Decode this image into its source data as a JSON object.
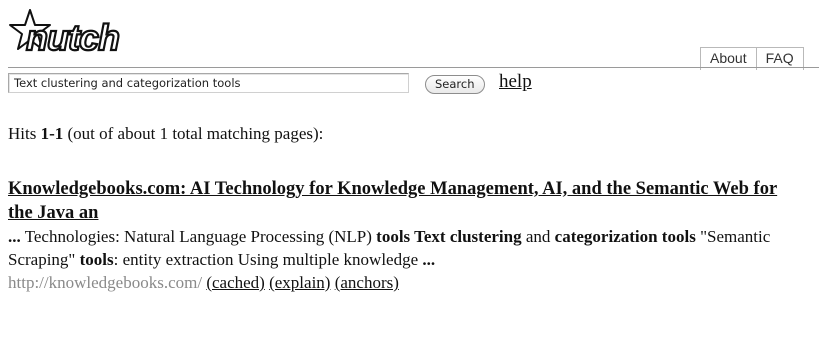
{
  "logo": {
    "text": "nutch",
    "icon": "star-logo-icon",
    "color": "#111111"
  },
  "tabs": [
    {
      "label": "About"
    },
    {
      "label": "FAQ"
    }
  ],
  "search": {
    "value": "Text clustering and categorization tools",
    "button_label": "Search",
    "help_label": "help"
  },
  "hits": {
    "prefix": "Hits ",
    "range": "1-1",
    "suffix": " (out of about 1 total matching pages):"
  },
  "result": {
    "title": "Knowledgebooks.com: AI Technology for Knowledge Management, AI, and the Semantic Web for the Java an",
    "snippet": [
      {
        "text": "...",
        "bold": true
      },
      {
        "text": " Technologies: Natural Language Processing (NLP) ",
        "bold": false
      },
      {
        "text": "tools Text clustering",
        "bold": true
      },
      {
        "text": " and ",
        "bold": false
      },
      {
        "text": "categorization tools",
        "bold": true
      },
      {
        "text": " \"Semantic Scraping\" ",
        "bold": false
      },
      {
        "text": "tools",
        "bold": true
      },
      {
        "text": ": entity extraction Using multiple knowledge ",
        "bold": false
      },
      {
        "text": "...",
        "bold": true
      }
    ],
    "url": "http://knowledgebooks.com/",
    "links": {
      "cached": "(cached)",
      "explain": "(explain)",
      "anchors": "(anchors)"
    }
  },
  "colors": {
    "text": "#111111",
    "url": "#8a8a8a",
    "rule": "#9a9a9a"
  }
}
